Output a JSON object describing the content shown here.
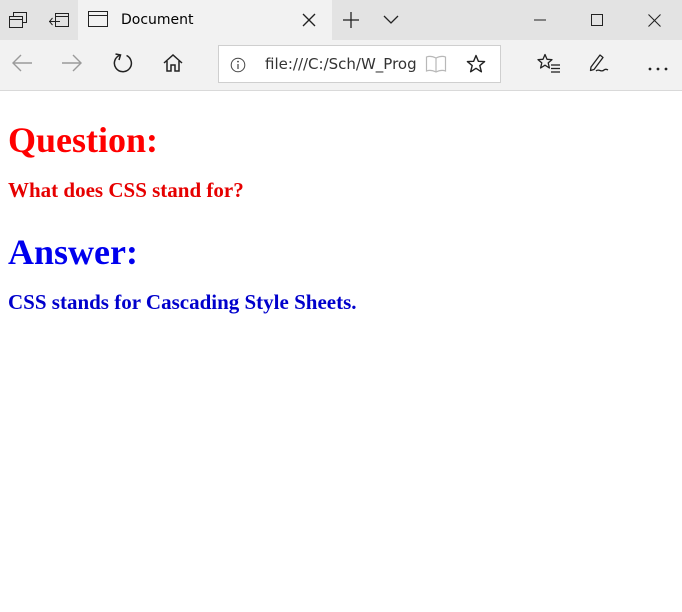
{
  "browser": {
    "tab": {
      "title": "Document"
    },
    "address_bar": {
      "url": "file:///C:/Sch/W_Prog"
    },
    "icons": {
      "tab_manager": "tabs-icon",
      "set_aside": "set-aside-tabs-icon",
      "page": "page-icon",
      "close_tab": "close-icon",
      "new_tab": "plus-icon",
      "tab_list": "chevron-down-icon",
      "minimize": "minimize-icon",
      "maximize": "maximize-icon",
      "close_window": "close-window-icon",
      "back": "back-arrow-icon",
      "forward": "forward-arrow-icon",
      "refresh": "refresh-icon",
      "home": "home-icon",
      "site_info": "info-icon",
      "reading_view": "book-icon",
      "favorite": "star-icon",
      "favorites_hub": "favorites-list-icon",
      "annotate": "pen-icon",
      "more": "more-icon"
    }
  },
  "page": {
    "question_heading": "Question:",
    "question_text": "What does CSS stand for?",
    "answer_heading": "Answer:",
    "answer_text": "CSS stands for Cascading Style Sheets."
  },
  "colors": {
    "question": "#ff0000",
    "answer": "#0000ee"
  }
}
